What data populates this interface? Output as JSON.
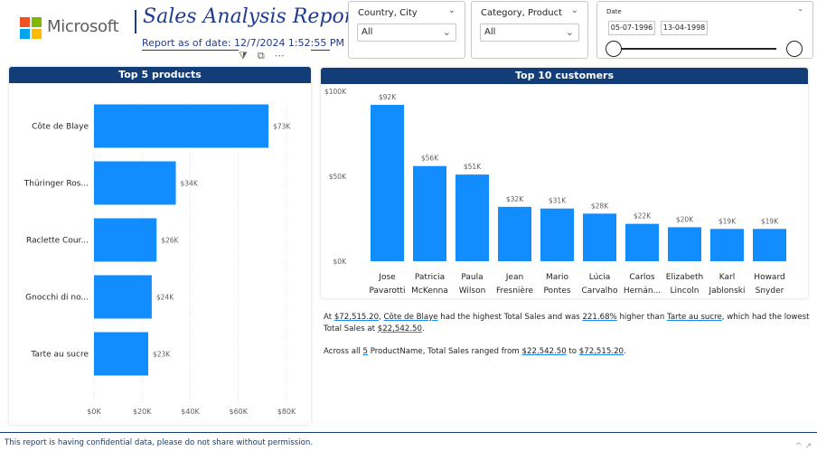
{
  "header": {
    "logo_text": "Microsoft",
    "logo_colors": [
      "#f25022",
      "#7fba00",
      "#00a4ef",
      "#ffb900"
    ],
    "title": "Sales Analysis Report",
    "date_label": "Report as of date: 12/7/2024 1:52:55 PM",
    "visual_header_icons": [
      "filter-icon",
      "focus-mode-icon",
      "more-options-icon"
    ]
  },
  "slicers": {
    "country": {
      "label": "Country, City",
      "value": "All"
    },
    "category": {
      "label": "Category, Product",
      "value": "All"
    },
    "date": {
      "label": "Date",
      "start": "05-07-1996",
      "end": "13-04-1998"
    }
  },
  "top_products": {
    "title": "Top 5 products"
  },
  "top_customers": {
    "title": "Top 10 customers"
  },
  "chart_data": [
    {
      "type": "bar",
      "orientation": "horizontal",
      "title": "Top 5 products",
      "categories": [
        "Côte de Blaye",
        "Thüringer Ros...",
        "Raclette Cour...",
        "Gnocchi di no...",
        "Tarte au sucre"
      ],
      "values": [
        72515.2,
        34000,
        26000,
        24000,
        22542.5
      ],
      "data_labels": [
        "$73K",
        "$34K",
        "$26K",
        "$24K",
        "$23K"
      ],
      "x_ticks": [
        "$0K",
        "$20K",
        "$40K",
        "$60K",
        "$80K"
      ],
      "xlim": [
        0,
        80000
      ],
      "grid": true,
      "color": "#118dff"
    },
    {
      "type": "bar",
      "orientation": "vertical",
      "title": "Top 10 customers",
      "categories": [
        [
          "Jose",
          "Pavarotti"
        ],
        [
          "Patricia",
          "McKenna"
        ],
        [
          "Paula",
          "Wilson"
        ],
        [
          "Jean",
          "Fresnière"
        ],
        [
          "Mario",
          "Pontes"
        ],
        [
          "Lúcia",
          "Carvalho"
        ],
        [
          "Carlos",
          "Hernán..."
        ],
        [
          "Elizabeth",
          "Lincoln"
        ],
        [
          "Karl",
          "Jablonski"
        ],
        [
          "Howard",
          "Snyder"
        ]
      ],
      "values": [
        92000,
        56000,
        51000,
        32000,
        31000,
        28000,
        22000,
        20000,
        19000,
        19000
      ],
      "data_labels": [
        "$92K",
        "$56K",
        "$51K",
        "$32K",
        "$31K",
        "$28K",
        "$22K",
        "$20K",
        "$19K",
        "$19K"
      ],
      "y_ticks": [
        "$0K",
        "$50K",
        "$100K"
      ],
      "ylim": [
        0,
        100000
      ],
      "grid": false,
      "color": "#118dff"
    }
  ],
  "narrative": {
    "p1": [
      "At ",
      "$72,515.20",
      ", ",
      "Côte de Blaye",
      " had the highest Total Sales and was ",
      "221.68%",
      " higher than ",
      "Tarte au sucre",
      ", which had the lowest Total Sales at ",
      "$22,542.50",
      "."
    ],
    "p2": [
      "Across all ",
      "5",
      " ProductName, Total Sales ranged from ",
      "$22,542.50",
      " to ",
      "$72,515.20",
      "."
    ]
  },
  "footer": {
    "text": "This report is having confidential data, please do not share without permission.",
    "corner": "^ ↗"
  }
}
